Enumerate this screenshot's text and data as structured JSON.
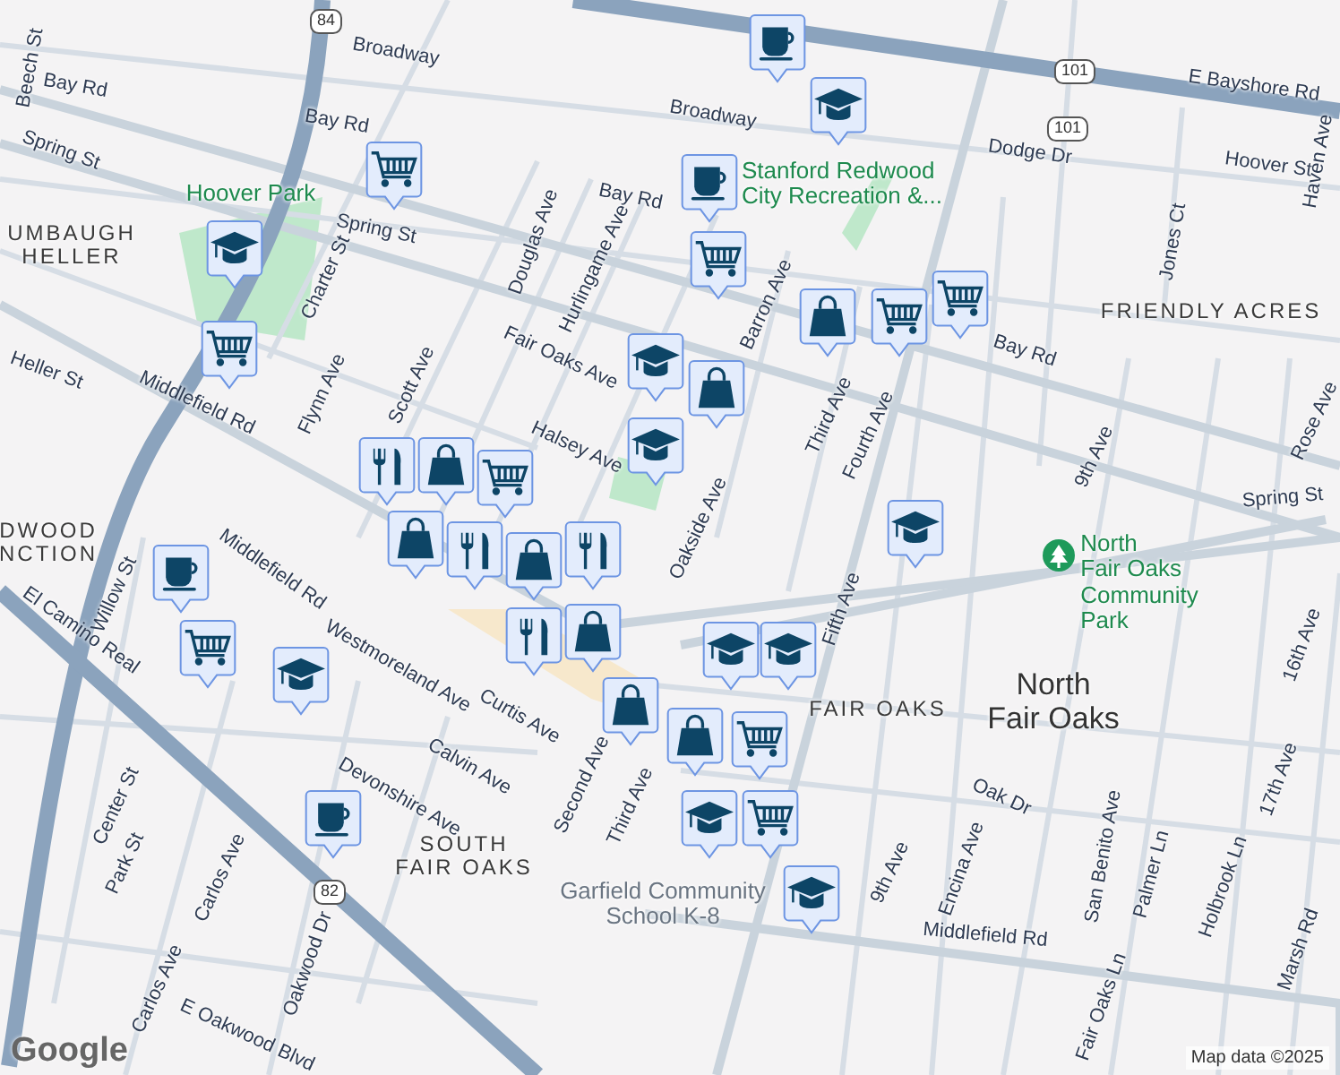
{
  "labels": [
    {
      "kind": "street",
      "text": "Broadway"
    },
    {
      "kind": "street",
      "text": "Broadway"
    },
    {
      "kind": "street",
      "text": "E Bayshore Rd"
    },
    {
      "kind": "street",
      "text": "Dodge Dr"
    },
    {
      "kind": "street",
      "text": "Hoover St"
    },
    {
      "kind": "street",
      "text": "Beech St"
    },
    {
      "kind": "street",
      "text": "Bay Rd"
    },
    {
      "kind": "street",
      "text": "Bay Rd"
    },
    {
      "kind": "street",
      "text": "Bay Rd"
    },
    {
      "kind": "street",
      "text": "Bay Rd"
    },
    {
      "kind": "street",
      "text": "Spring St"
    },
    {
      "kind": "street",
      "text": "Spring St"
    },
    {
      "kind": "street",
      "text": "Spring St"
    },
    {
      "kind": "street",
      "text": "Heller St"
    },
    {
      "kind": "street",
      "text": "Middlefield Rd"
    },
    {
      "kind": "street",
      "text": "Middlefield Rd"
    },
    {
      "kind": "street",
      "text": "Middlefield Rd"
    },
    {
      "kind": "street",
      "text": "Charter St"
    },
    {
      "kind": "street",
      "text": "Flynn Ave"
    },
    {
      "kind": "street",
      "text": "Scott Ave"
    },
    {
      "kind": "street",
      "text": "Douglas Ave"
    },
    {
      "kind": "street",
      "text": "Hurlingame Ave"
    },
    {
      "kind": "street",
      "text": "Fair Oaks Ave"
    },
    {
      "kind": "street",
      "text": "Halsey Ave"
    },
    {
      "kind": "street",
      "text": "Oakside Ave"
    },
    {
      "kind": "street",
      "text": "Barron Ave"
    },
    {
      "kind": "street",
      "text": "Third Ave"
    },
    {
      "kind": "street",
      "text": "Fourth Ave"
    },
    {
      "kind": "street",
      "text": "Fifth Ave"
    },
    {
      "kind": "street",
      "text": "9th Ave"
    },
    {
      "kind": "street",
      "text": "Jones Ct"
    },
    {
      "kind": "street",
      "text": "Haven Ave"
    },
    {
      "kind": "street",
      "text": "Rose Ave"
    },
    {
      "kind": "street",
      "text": "16th Ave"
    },
    {
      "kind": "street",
      "text": "Willow St"
    },
    {
      "kind": "street",
      "text": "El Camino Real"
    },
    {
      "kind": "street",
      "text": "Curtis Ave"
    },
    {
      "kind": "street",
      "text": "Calvin Ave"
    },
    {
      "kind": "street",
      "text": "Westmoreland Ave"
    },
    {
      "kind": "street",
      "text": "Devonshire Ave"
    },
    {
      "kind": "street",
      "text": "Second Ave"
    },
    {
      "kind": "street",
      "text": "Third Ave"
    },
    {
      "kind": "street",
      "text": "Center St"
    },
    {
      "kind": "street",
      "text": "Park St"
    },
    {
      "kind": "street",
      "text": "Carlos Ave"
    },
    {
      "kind": "street",
      "text": "Carlos Ave"
    },
    {
      "kind": "street",
      "text": "Oakwood Dr"
    },
    {
      "kind": "street",
      "text": "E Oakwood Blvd"
    },
    {
      "kind": "street",
      "text": "Oak Dr"
    },
    {
      "kind": "street",
      "text": "Encina Ave"
    },
    {
      "kind": "street",
      "text": "9th Ave"
    },
    {
      "kind": "street",
      "text": "San Benito Ave"
    },
    {
      "kind": "street",
      "text": "Palmer Ln"
    },
    {
      "kind": "street",
      "text": "Holbrook Ln"
    },
    {
      "kind": "street",
      "text": "17th Ave"
    },
    {
      "kind": "street",
      "text": "Marsh Rd"
    },
    {
      "kind": "street",
      "text": "Fair Oaks Ln"
    },
    {
      "kind": "area",
      "text": "FRIENDLY ACRES"
    },
    {
      "kind": "area",
      "text": "SOUTH\nFAIR OAKS"
    },
    {
      "kind": "area",
      "text": "FAIR OAKS"
    },
    {
      "kind": "area",
      "text": "UMBAUGH\nHELLER"
    },
    {
      "kind": "area",
      "text": "DWOOD\nNCTION"
    },
    {
      "kind": "place",
      "text": "North\nFair Oaks"
    },
    {
      "kind": "park",
      "text": "Hoover Park"
    },
    {
      "kind": "park",
      "text": "Stanford Redwood\nCity Recreation &..."
    },
    {
      "kind": "park",
      "text": "North\nFair Oaks\nCommunity\nPark"
    },
    {
      "kind": "poi",
      "text": "Garfield Community\nSchool K-8"
    },
    {
      "kind": "shield",
      "text": "84"
    },
    {
      "kind": "shield",
      "text": "101"
    },
    {
      "kind": "shield",
      "text": "101"
    },
    {
      "kind": "shield",
      "text": "82"
    }
  ],
  "pins": [
    {
      "kind": "cart"
    },
    {
      "kind": "school"
    },
    {
      "kind": "cart"
    },
    {
      "kind": "cafe"
    },
    {
      "kind": "school"
    },
    {
      "kind": "cafe"
    },
    {
      "kind": "cart"
    },
    {
      "kind": "school"
    },
    {
      "kind": "school"
    },
    {
      "kind": "bag"
    },
    {
      "kind": "bag"
    },
    {
      "kind": "cart"
    },
    {
      "kind": "cart"
    },
    {
      "kind": "restaurant"
    },
    {
      "kind": "bag"
    },
    {
      "kind": "cart"
    },
    {
      "kind": "bag"
    },
    {
      "kind": "restaurant"
    },
    {
      "kind": "bag"
    },
    {
      "kind": "restaurant"
    },
    {
      "kind": "school"
    },
    {
      "kind": "cafe"
    },
    {
      "kind": "cart"
    },
    {
      "kind": "school"
    },
    {
      "kind": "restaurant"
    },
    {
      "kind": "bag"
    },
    {
      "kind": "bag"
    },
    {
      "kind": "school"
    },
    {
      "kind": "school"
    },
    {
      "kind": "bag"
    },
    {
      "kind": "cart"
    },
    {
      "kind": "school"
    },
    {
      "kind": "cart"
    },
    {
      "kind": "school"
    },
    {
      "kind": "cafe"
    }
  ],
  "attribution": {
    "logo": "Google",
    "text": "Map data ©2025"
  }
}
